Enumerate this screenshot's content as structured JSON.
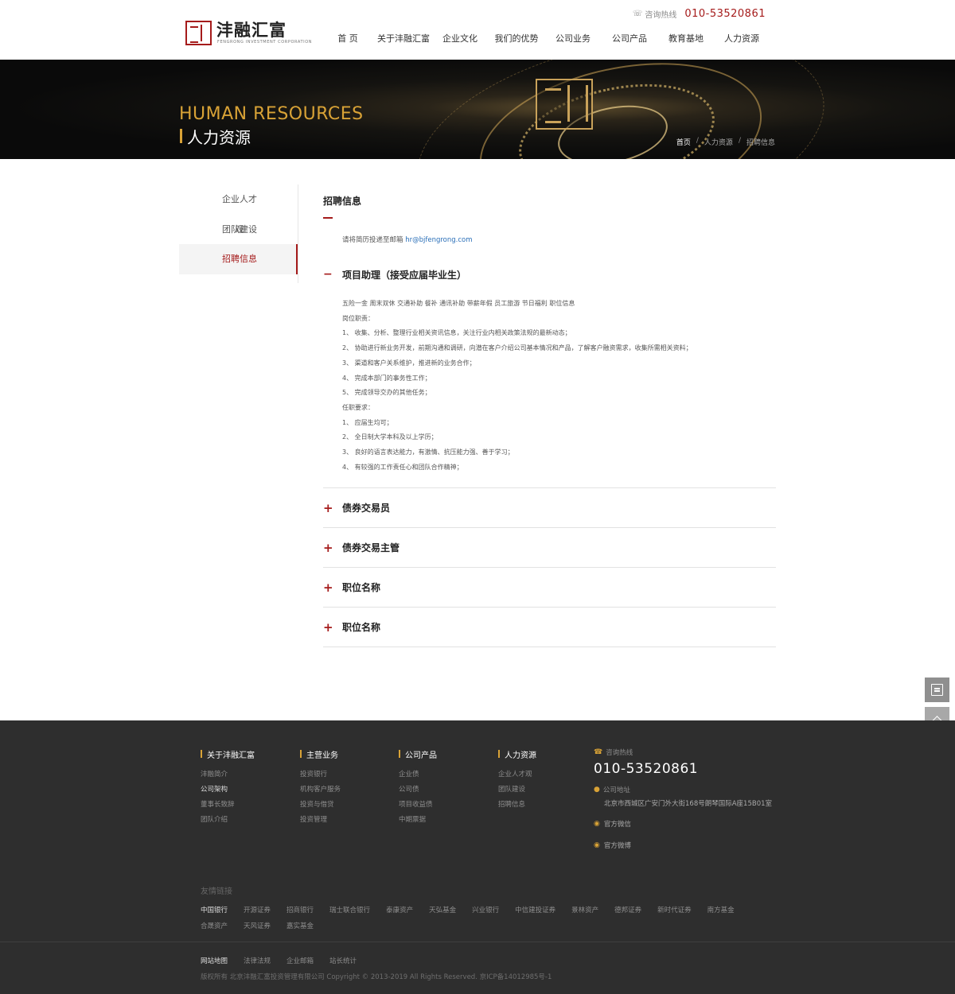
{
  "header": {
    "logo_text": "沣融汇富",
    "logo_sub": "FENGRONG INVESTMENT CORPORATION",
    "hotline_label": "咨询热线",
    "hotline_number": "010-53520861",
    "nav": [
      "首 页",
      "关于沣融汇富",
      "企业文化",
      "我们的优势",
      "公司业务",
      "公司产品",
      "教育基地",
      "人力资源"
    ]
  },
  "banner": {
    "title_en": "HUMAN RESOURCES",
    "title_cn": "人力资源",
    "breadcrumb": [
      "首页",
      "人力资源",
      "招聘信息"
    ],
    "breadcrumb_sep": "/"
  },
  "sidebar": {
    "items": [
      {
        "label": "企业人才观",
        "active": false
      },
      {
        "label": "团队建设",
        "active": false
      },
      {
        "label": "招聘信息",
        "active": true
      }
    ]
  },
  "main": {
    "title": "招聘信息",
    "email_prefix": "请将简历投递至邮箱",
    "email": "hr@bjfengrong.com",
    "open_job": {
      "toggle": "−",
      "title": "项目助理（接受应届毕业生）",
      "lines": [
        "五险一金  周末双休  交通补助  餐补  通讯补助  带薪年假  员工旅游  节日福利  职位信息",
        "岗位职责：",
        "1、  收集、分析、整理行业相关资讯信息，关注行业内相关政策法规的最新动态；",
        "2、  协助进行新业务开发，前期沟通和调研，向潜在客户介绍公司基本情况和产品，了解客户融资需求，收集所需相关资料；",
        "3、  渠道和客户关系维护，推进新的业务合作；",
        "4、  完成本部门的事务性工作；",
        "5、  完成领导交办的其他任务；",
        "任职要求：",
        "1、  应届生均可；",
        "2、  全日制大学本科及以上学历；",
        "3、  良好的语言表达能力，有激情、抗压能力强、善于学习；",
        "4、  有较强的工作责任心和团队合作精神；"
      ]
    },
    "closed_jobs": [
      {
        "toggle": "+",
        "title": "债券交易员"
      },
      {
        "toggle": "+",
        "title": "债券交易主管"
      },
      {
        "toggle": "+",
        "title": "职位名称"
      },
      {
        "toggle": "+",
        "title": "职位名称"
      }
    ]
  },
  "footer": {
    "columns": [
      {
        "title": "关于沣融汇富",
        "items": [
          "沣融简介",
          "公司架构",
          "董事长致辞",
          "团队介绍"
        ]
      },
      {
        "title": "主营业务",
        "items": [
          "投资银行",
          "机构客户服务",
          "投资与借贷",
          "投资管理"
        ]
      },
      {
        "title": "公司产品",
        "items": [
          "企业债",
          "公司债",
          "项目收益债",
          "中期票据"
        ]
      },
      {
        "title": "人力资源",
        "items": [
          "企业人才观",
          "团队建设",
          "招聘信息"
        ]
      }
    ],
    "contact": {
      "hotline_label": "咨询热线",
      "hotline_number": "010-53520861",
      "address_label": "公司地址",
      "address": "北京市西城区广安门外大街168号朗琴国际A座15B01室",
      "wechat": "官方微信",
      "weibo": "官方微博"
    },
    "links_title": "友情链接",
    "links": [
      "中国银行",
      "开源证券",
      "招商银行",
      "瑞士联合银行",
      "泰康资产",
      "天弘基金",
      "兴业银行",
      "中信建投证券",
      "景林资产",
      "德邦证券",
      "新时代证券",
      "南方基金",
      "合晟资产",
      "天风证券",
      "嘉实基金"
    ],
    "bottom_nav": [
      "网站地图",
      "法律法规",
      "企业邮箱",
      "站长统计"
    ],
    "copyright": "版权所有 北京沣融汇富投资管理有限公司 Copyright © 2013-2019 All Rights Reserved.  京ICP备14012985号-1"
  },
  "float_tools": {
    "feedback_icon": "edit-icon",
    "top_icon": "chevron-up-icon"
  },
  "colors": {
    "accent_red": "#a51b1b",
    "gold": "#d8a236",
    "footer_bg": "#2e2e2e",
    "link_blue": "#2a6fb8"
  }
}
